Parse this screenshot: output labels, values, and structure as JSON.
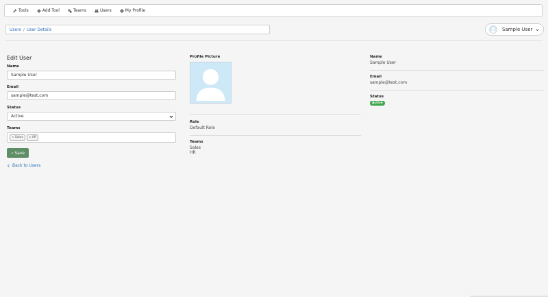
{
  "nav": {
    "tools": "Tools",
    "add_tool": "Add Tool",
    "teams": "Teams",
    "users": "Users",
    "my_profile": "My Profile"
  },
  "breadcrumb": {
    "users": "Users",
    "separator": "/",
    "current": "User Details"
  },
  "user_menu": {
    "name": "Sample User"
  },
  "form": {
    "title": "Edit User",
    "name_label": "Name",
    "name_value": "Sample User",
    "email_label": "Email",
    "email_value": "sample@test.com",
    "status_label": "Status",
    "status_value": "Active",
    "teams_label": "Teams",
    "teams_tags": [
      "Sales",
      "HR"
    ],
    "save_label": "Save",
    "back_label": "Back to Users"
  },
  "profile": {
    "picture_label": "Profile Picture",
    "role_label": "Role",
    "role_value": "Default Role",
    "teams_label": "Teams",
    "teams_values": [
      "Sales",
      "HR"
    ]
  },
  "details": {
    "name_label": "Name",
    "name_value": "Sample User",
    "email_label": "Email",
    "email_value": "sample@test.com",
    "status_label": "Status",
    "status_value": "Active"
  },
  "colors": {
    "accent_link": "#2a6fb5",
    "save_button": "#5d8e66",
    "status_badge": "#3fa64b",
    "avatar_bg": "#cde8f7"
  },
  "icons": [
    "wrench-icon",
    "plus-icon",
    "cogs-icon",
    "users-icon",
    "gear-icon",
    "check-icon",
    "chevron-down-icon",
    "chevron-left-icon",
    "avatar-icon"
  ]
}
